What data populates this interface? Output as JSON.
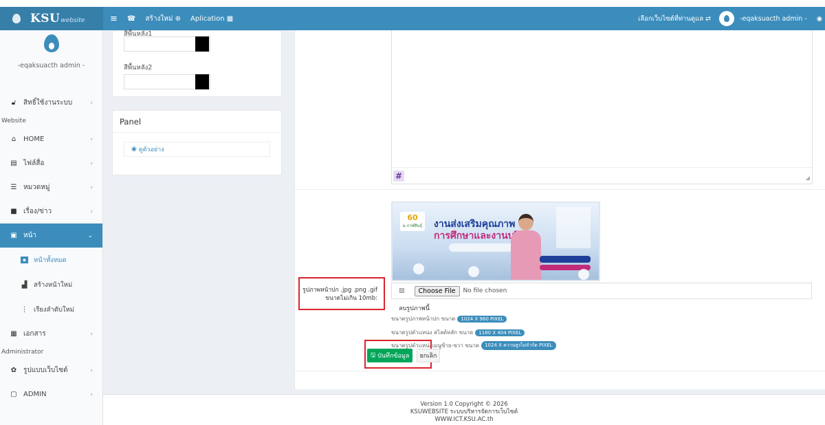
{
  "header": {
    "brand_main": "KSU",
    "brand_sub": "website",
    "menu_icon": "hamburger-icon",
    "new_label": "สร้างใหม่",
    "app_label": "Aplication",
    "select_site": "เลือกเว็บไซต์ที่ท่านดูแล",
    "user": "-eqaksuacth admin -"
  },
  "sidebar": {
    "username": "-eqaksuacth admin -",
    "rights": "สิทธิ์ใช้งานระบบ",
    "section_website": "Website",
    "items": [
      {
        "label": "HOME",
        "icon": "home-icon"
      },
      {
        "label": "ไฟล์สื่อ",
        "icon": "media-icon"
      },
      {
        "label": "หมวดหมู่",
        "icon": "category-icon"
      },
      {
        "label": "เรื่อง/ข่าว",
        "icon": "news-icon"
      },
      {
        "label": "หน้า",
        "icon": "page-icon"
      }
    ],
    "sub_items": [
      {
        "label": "หน้าทั้งหมด"
      },
      {
        "label": "สร้างหน้าใหม่"
      },
      {
        "label": "เรียงลำดับใหม่"
      }
    ],
    "documents": "เอกสาร",
    "section_admin": "Administrator",
    "theme": "รูปแบบเว็บไซต์",
    "admin": "ADMIN"
  },
  "colorbox": {
    "label1": "สีพื้นหลัง1",
    "label2": "สีพื้นหลัง2",
    "swatch_color": "#000000"
  },
  "panel": {
    "title": "Panel",
    "preview": "ดูตัวอย่าง"
  },
  "editor": {
    "toolbar_symbol": "#"
  },
  "banner": {
    "logo_num": "60",
    "logo_text": "ม.กาฬสินธุ์",
    "line1": "งานส่งเสริมคุณภาพ",
    "line2": "การศึกษาและงานบริหาร"
  },
  "upload": {
    "label_line1": "รูปภาพหน้าปก .jpg .png .gif",
    "label_line2": "ขนาดไม่เกิน 10mb:",
    "choose_button": "Choose File",
    "no_file": "No file chosen",
    "delete_image": "ลบรูปภาพนี้",
    "hint1": "ขนาดรูปภาพหน้าปก ขนาด",
    "size1": "1024 X 960 PIXEL",
    "hint2": "ขนาดรูปตำแหน่ง สไลด์หลัก ขนาด",
    "size2": "1180 X 404 PIXEL",
    "hint3": "ขนาดรูปตำแหน่งเมนูซ้าย-ขวา ขนาด",
    "size3": "1024 X ความสูงไม่จำกัด PIXEL"
  },
  "actions": {
    "save": "บันทึกข้อมูล",
    "cancel": "ยกเลิก"
  },
  "footer": {
    "line1": "Version 1.0 Copyright © 2026",
    "line2": "KSUWEBSITE ระบบบริหารจัดการเว็บไซต์",
    "line3": "WWW.ICT.KSU.AC.th"
  }
}
